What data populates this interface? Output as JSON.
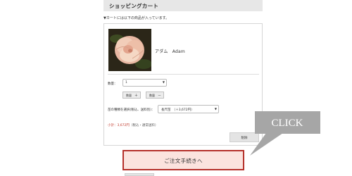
{
  "cart": {
    "title": "ショッピングカート",
    "note": "▼カートには以下の商品が入っています。"
  },
  "product": {
    "name": "アダム　Adam"
  },
  "quantity": {
    "label": "数量：",
    "value": "1",
    "increase_label": "数量",
    "increase_symbol": "＋",
    "decrease_label": "数量",
    "decrease_symbol": "－"
  },
  "shipping": {
    "label": "苗の種類を選択(税込、送料別)：",
    "selected": "長尺苗　（＋3,672円）"
  },
  "subtotal": {
    "label": "小計：",
    "price": "3,672円",
    "suffix": "（税込・通常送料）"
  },
  "delete_button": "削除",
  "checkout_button": "ご注文手続きへ",
  "callout": {
    "text": "CLICK",
    "color": "#a6a6a6"
  },
  "colors": {
    "header_bg": "#e7e7e7",
    "checkout_border": "#b5302a",
    "checkout_bg": "#fbe3de",
    "price": "#c0392b"
  }
}
